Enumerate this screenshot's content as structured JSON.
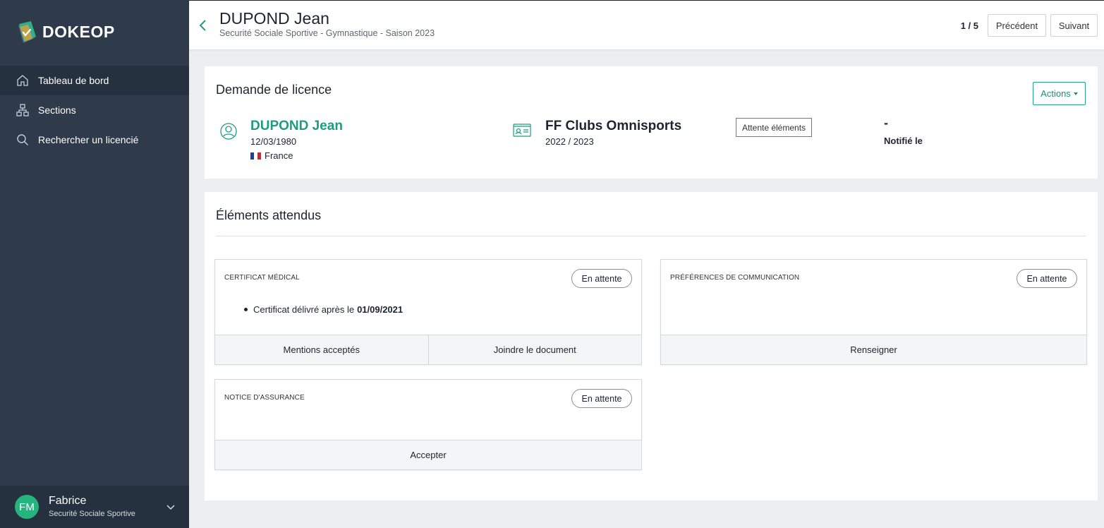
{
  "brand": {
    "name": "DOKEOP"
  },
  "sidebar": {
    "items": [
      {
        "label": "Tableau de bord",
        "icon": "home-icon"
      },
      {
        "label": "Sections",
        "icon": "sitemap-icon"
      },
      {
        "label": "Rechercher un licencié",
        "icon": "search-icon"
      }
    ],
    "user": {
      "initials": "FM",
      "name": "Fabrice",
      "org": "Securité Sociale Sportive"
    }
  },
  "header": {
    "title": "DUPOND Jean",
    "subtitle": "Securité Sociale Sportive - Gymnastique - Saison 2023",
    "pager": "1 / 5",
    "prev_label": "Précédent",
    "next_label": "Suivant"
  },
  "license": {
    "title": "Demande de licence",
    "actions_label": "Actions",
    "person": {
      "name": "DUPOND Jean",
      "dob": "12/03/1980",
      "country": "France"
    },
    "federation": {
      "name": "FF Clubs Omnisports",
      "season": "2022 / 2023"
    },
    "status": "Attente éléments",
    "notified_value": "-",
    "notified_label": "Notifié le"
  },
  "expected": {
    "title": "Éléments attendus",
    "items": [
      {
        "title": "Certificat médical",
        "status": "En attente",
        "bullet_text": "Certificat délivré après le",
        "bullet_date": "01/09/2021",
        "actions": [
          "Mentions acceptés",
          "Joindre le document"
        ]
      },
      {
        "title": "Préférences de communication",
        "status": "En attente",
        "actions": [
          "Renseigner"
        ]
      },
      {
        "title": "Notice d'assurance",
        "status": "En attente",
        "actions": [
          "Accepter"
        ]
      }
    ]
  },
  "colors": {
    "sidebar": "#2f3a4a",
    "accent": "#1f9b80",
    "avatar": "#24b47e"
  }
}
